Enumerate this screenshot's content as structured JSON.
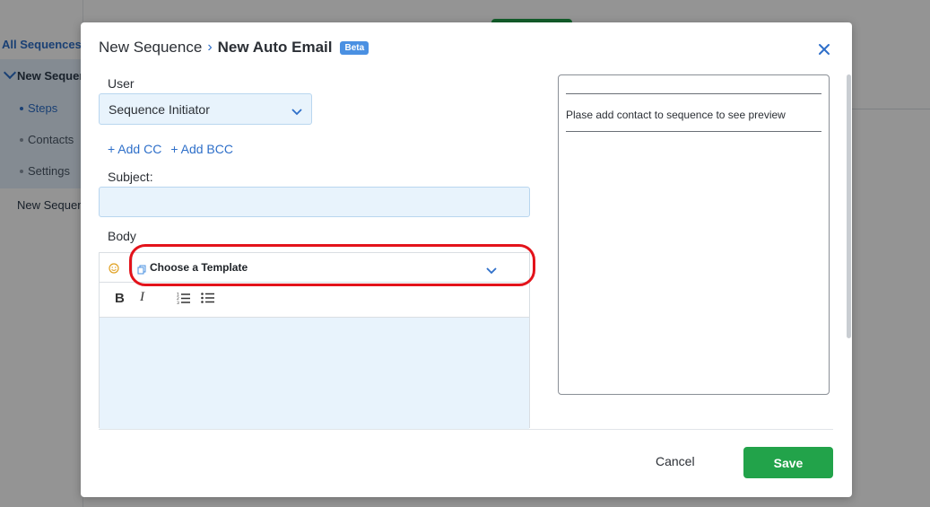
{
  "background": {
    "sidebar": {
      "all_sequences": "All Sequences",
      "current_sequence": "New Sequence",
      "sub_items": [
        "Steps",
        "Contacts",
        "Settings"
      ],
      "other_sequence": "New Sequence"
    }
  },
  "modal": {
    "breadcrumb": {
      "parent": "New Sequence",
      "separator": "›",
      "current": "New Auto Email",
      "badge": "Beta"
    },
    "close_icon": "close-icon",
    "user": {
      "label": "User",
      "value": "Sequence Initiator"
    },
    "cc": {
      "add_cc": "+ Add CC",
      "add_bcc": "+ Add BCC"
    },
    "subject": {
      "label": "Subject:",
      "value": ""
    },
    "body": {
      "label": "Body",
      "template_placeholder": "Choose a Template",
      "toolbar": {
        "bold": "B",
        "italic": "I"
      }
    },
    "preview": {
      "message": "Plase add contact to sequence to see preview"
    },
    "footer": {
      "cancel": "Cancel",
      "save": "Save"
    }
  },
  "colors": {
    "accent": "#2e6fc9",
    "primary_button": "#22a34a",
    "highlight": "#e3131b",
    "beta_badge": "#4a90e2",
    "input_bg": "#e8f3fc"
  }
}
